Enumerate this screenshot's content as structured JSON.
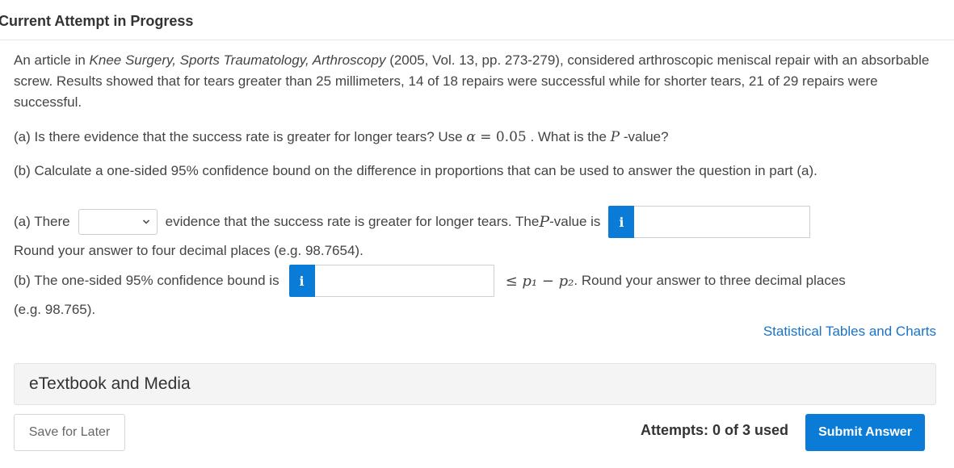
{
  "header": {
    "title": "Current Attempt in Progress"
  },
  "problem": {
    "intro_before": "An article in ",
    "journal": "Knee Surgery, Sports Traumatology, Arthroscopy",
    "intro_after": " (2005, Vol. 13, pp. 273-279), considered arthroscopic meniscal repair with an absorbable screw. Results showed that for tears greater than 25 millimeters, 14 of 18 repairs were successful while for shorter tears, 21 of 29 repairs were successful.",
    "part_a_q_start": "(a) Is there evidence that the success rate is greater for longer tears? Use ",
    "alpha_sym": "α",
    "alpha_eq": " = 0.05",
    "part_a_q_mid": " . What is the ",
    "p_sym": "P",
    "part_a_q_end": " -value?",
    "part_b_q": "(b) Calculate a one-sided 95% confidence bound on the difference in proportions that can be used to answer the question in part (a)."
  },
  "answer_a": {
    "prefix": "(a) There",
    "select_value": "",
    "middle": "evidence that the success rate is greater for longer tears. The ",
    "p_sym": "P",
    "suffix": " -value is",
    "info_label": "i",
    "input_value": "",
    "round_note": "Round your answer to four decimal places (e.g. 98.7654)."
  },
  "answer_b": {
    "prefix": "(b) The one-sided 95% confidence bound is",
    "info_label": "i",
    "input_value": "",
    "relation": "≤ p₁ − p₂",
    "suffix": " . Round your answer to three decimal places",
    "example": "(e.g. 98.765)."
  },
  "links": {
    "tables": "Statistical Tables and Charts"
  },
  "etextbook": {
    "label": "eTextbook and Media"
  },
  "footer": {
    "save_label": "Save for Later",
    "attempts": "Attempts: 0 of 3 used",
    "submit_label": "Submit Answer"
  },
  "colors": {
    "accent": "#0a7bd6",
    "link": "#1a73c7"
  },
  "icons": {
    "select_chevron": "chevron-down-icon",
    "info": "info-icon"
  }
}
